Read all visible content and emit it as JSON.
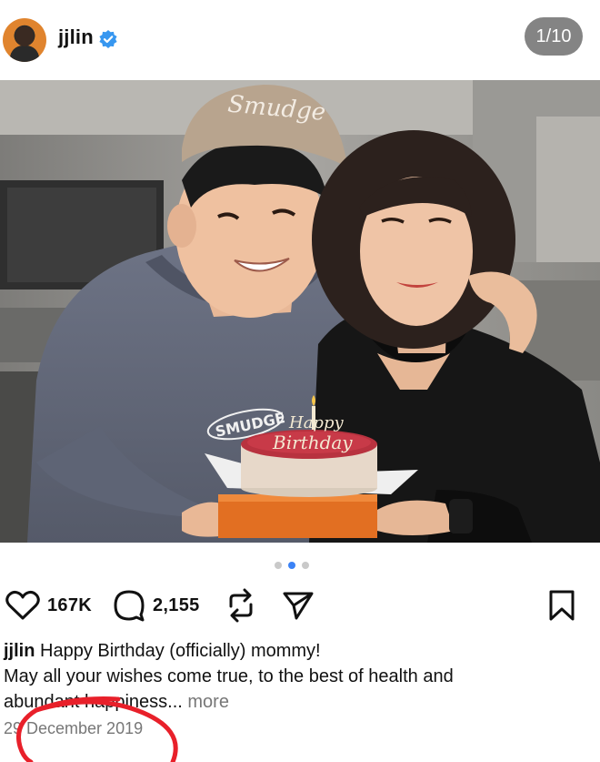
{
  "header": {
    "username": "jjlin",
    "avatar_icon": "avatar-icon",
    "verified_icon": "verified-badge-icon",
    "counter": "1/10"
  },
  "photo": {
    "cap_text": "Smudge",
    "sweater_text": "SMUDGE",
    "cake_text_1": "Happy",
    "cake_text_2": "Birthday"
  },
  "carousel": {
    "total_dots": 3,
    "active_index": 1,
    "active_color": "#3b82f6"
  },
  "actions": {
    "likes": "167K",
    "comments": "2,155",
    "like_icon": "heart-icon",
    "comment_icon": "comment-icon",
    "repost_icon": "repost-icon",
    "share_icon": "send-icon",
    "save_icon": "bookmark-icon"
  },
  "caption": {
    "username": "jjlin",
    "line1": " Happy Birthday (officially) mommy!",
    "line2": "May all your wishes come true, to the best of health and",
    "line3": "abundant happiness...",
    "more": " more"
  },
  "date": "29 December 2019",
  "annotation_color": "#e8202a"
}
